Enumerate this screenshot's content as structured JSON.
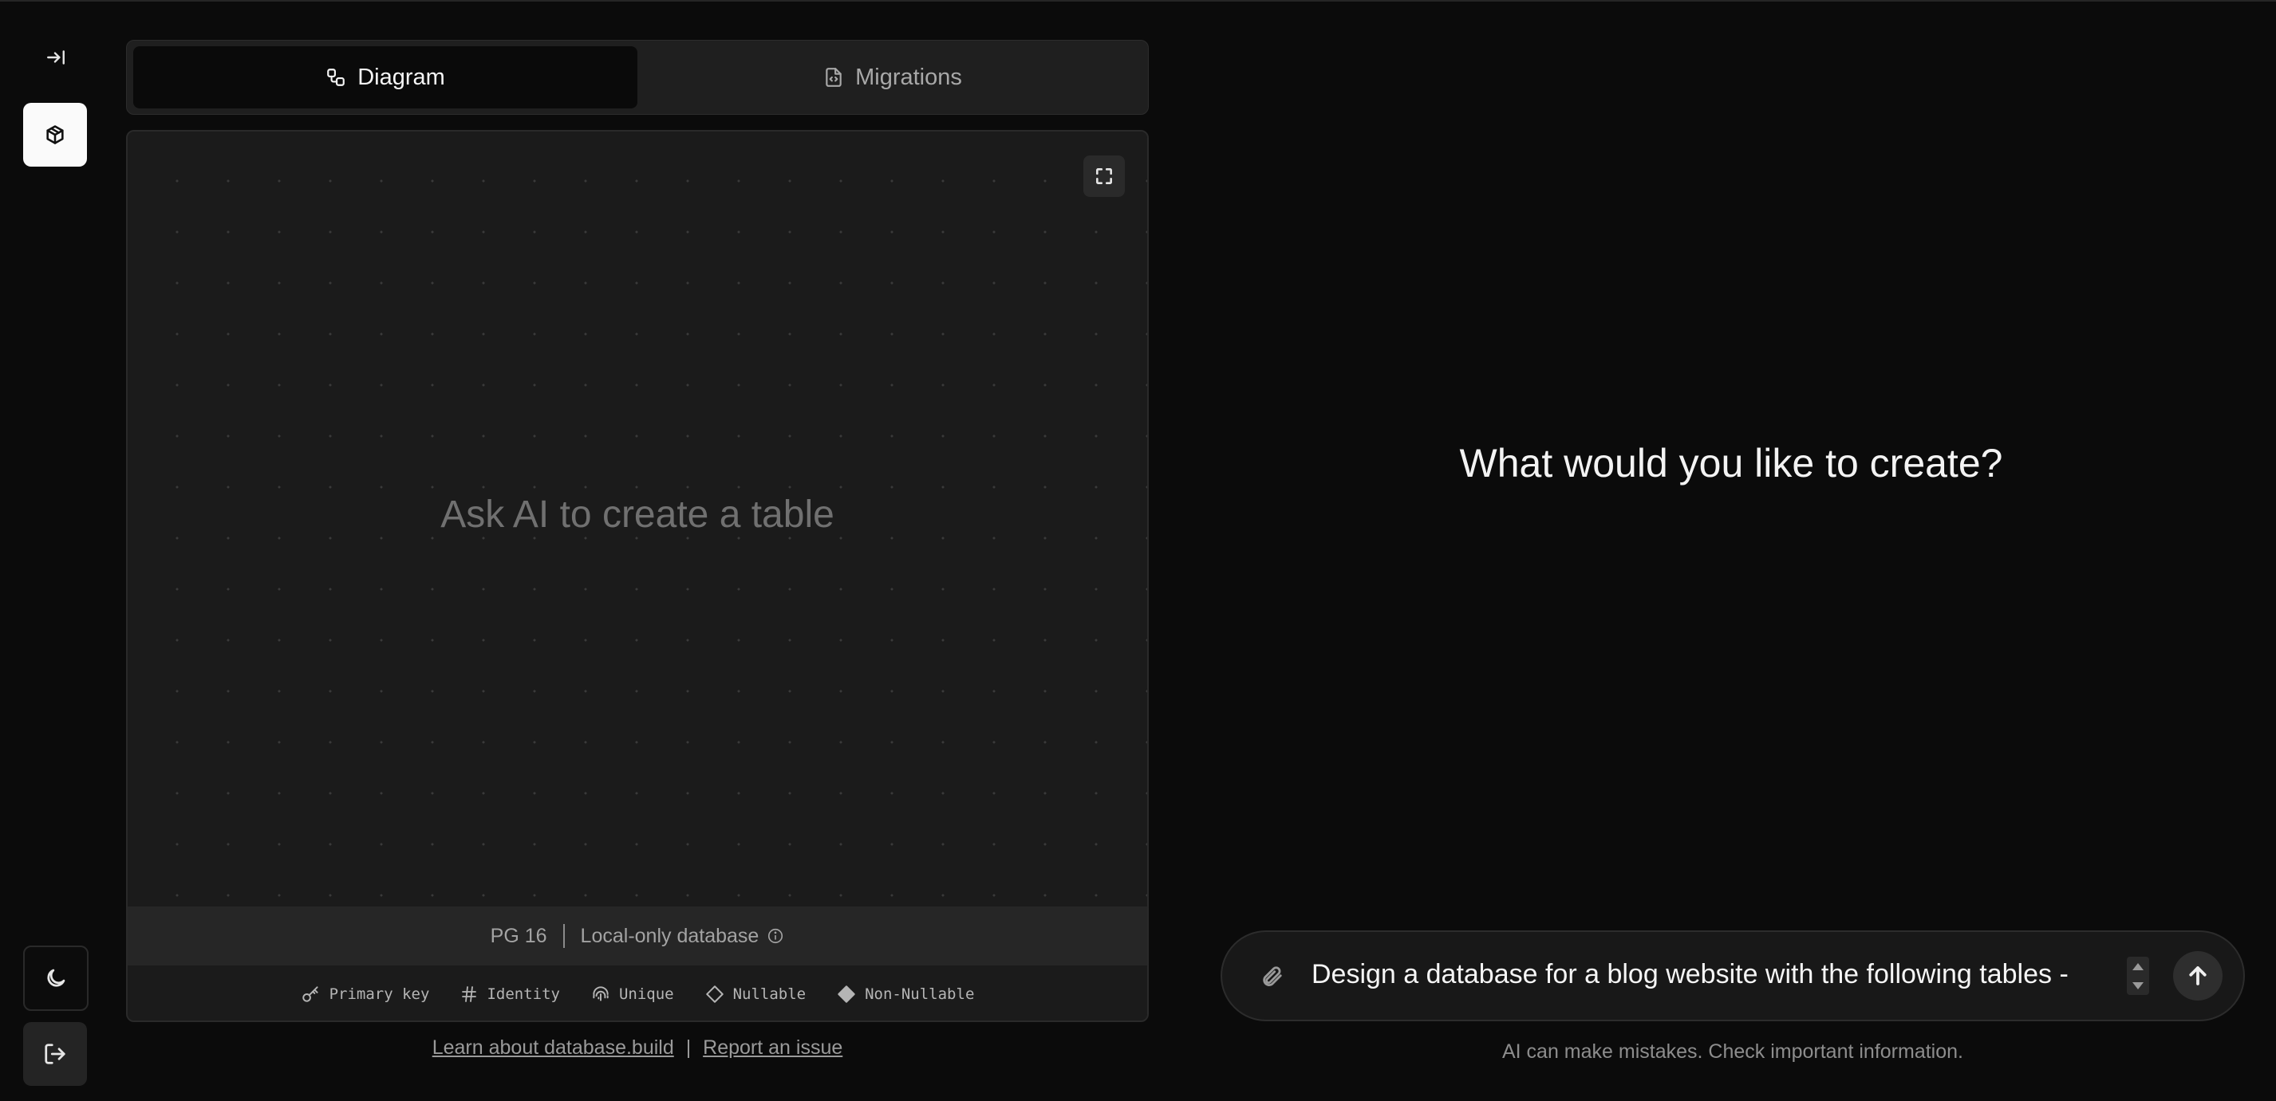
{
  "tabs": {
    "diagram": "Diagram",
    "migrations": "Migrations"
  },
  "diagram": {
    "empty_message": "Ask AI to create a table"
  },
  "status": {
    "version": "PG 16",
    "database": "Local-only database"
  },
  "legend": {
    "primary_key": "Primary key",
    "identity": "Identity",
    "unique": "Unique",
    "nullable": "Nullable",
    "non_nullable": "Non-Nullable"
  },
  "footer": {
    "learn_link": "Learn about database.build",
    "separator": "|",
    "report_link": "Report an issue"
  },
  "chat": {
    "heading": "What would you like to create?",
    "input_value": "Design a database for a blog website with the following tables -",
    "disclaimer": "AI can make mistakes. Check important information."
  },
  "icons": {
    "collapse": "arrow-right-to-line-icon",
    "logo": "package-icon",
    "theme": "moon-icon",
    "signout": "log-out-icon",
    "diagram_tab": "workflow-icon",
    "migrations_tab": "file-code-icon",
    "fullscreen": "fullscreen-icon",
    "info": "info-icon",
    "attach": "paperclip-icon",
    "send": "arrow-up-icon"
  },
  "colors": {
    "background": "#0b0b0b",
    "panel": "#1b1b1b",
    "accent": "#fafafa"
  }
}
